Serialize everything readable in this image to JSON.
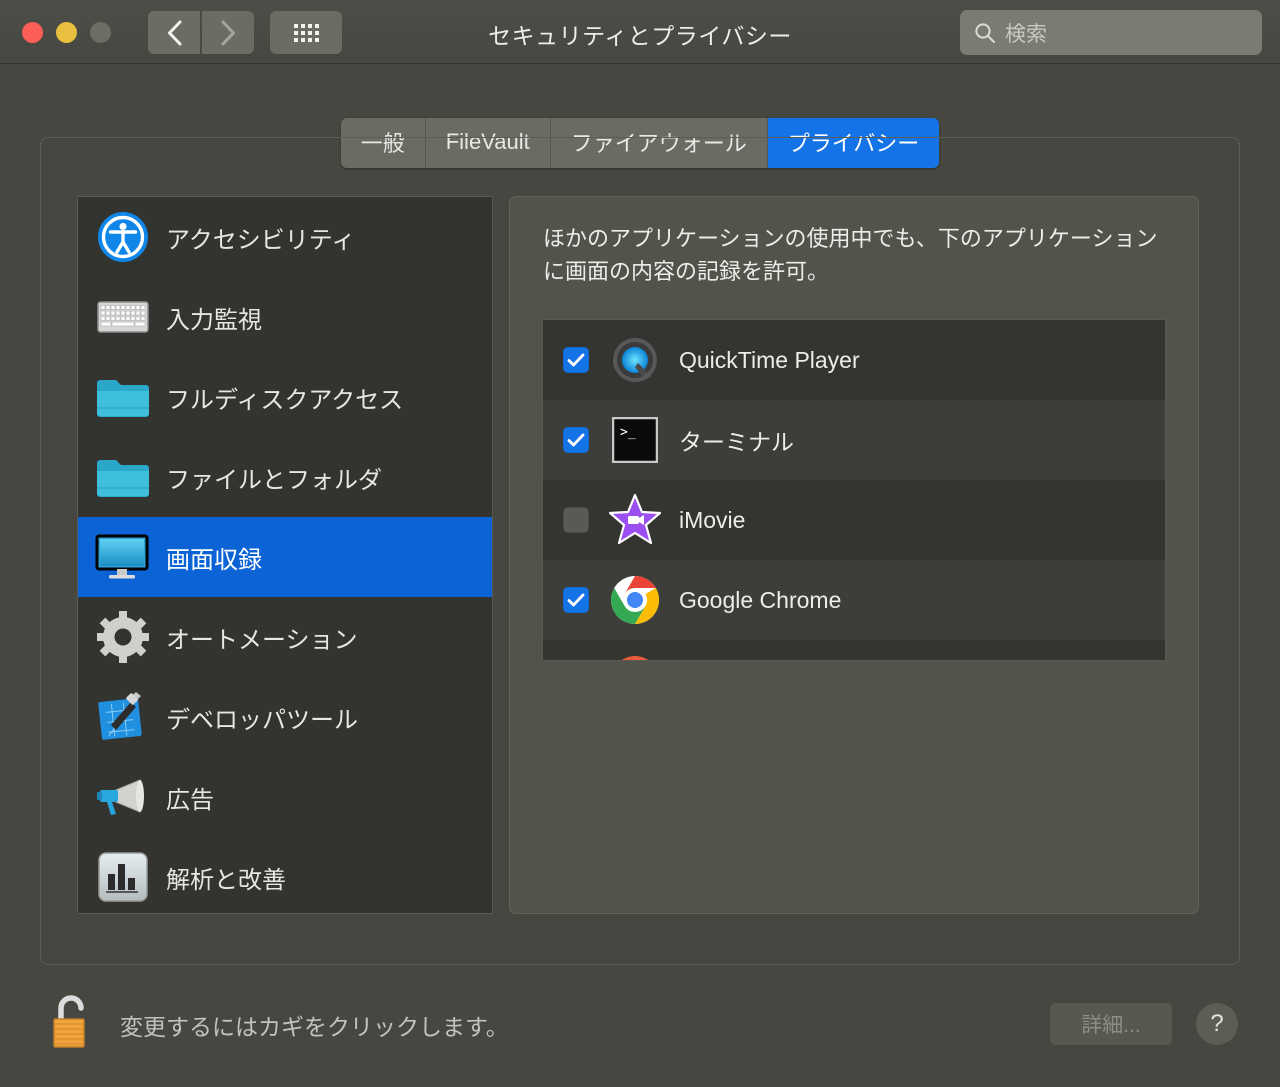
{
  "window": {
    "title": "セキュリティとプライバシー",
    "traffic_lights": [
      {
        "name": "close",
        "color": "#fb5f57"
      },
      {
        "name": "minimize",
        "color": "#e9bf3f"
      },
      {
        "name": "zoom",
        "color": "#6d6d66"
      }
    ]
  },
  "toolbar": {
    "back_icon": "chevron-left-icon",
    "forward_icon": "chevron-right-icon",
    "grid_icon": "show-all-grid-icon"
  },
  "search": {
    "icon": "search-icon",
    "placeholder": "検索",
    "value": ""
  },
  "tabs": [
    {
      "label": "一般",
      "selected": false
    },
    {
      "label": "FileVault",
      "selected": false
    },
    {
      "label": "ファイアウォール",
      "selected": false
    },
    {
      "label": "プライバシー",
      "selected": true
    }
  ],
  "sidebar": {
    "items": [
      {
        "label": "アクセシビリティ",
        "icon": "accessibility-icon",
        "selected": false
      },
      {
        "label": "入力監視",
        "icon": "keyboard-icon",
        "selected": false
      },
      {
        "label": "フルディスクアクセス",
        "icon": "folder-icon",
        "selected": false
      },
      {
        "label": "ファイルとフォルダ",
        "icon": "folder-icon",
        "selected": false
      },
      {
        "label": "画面収録",
        "icon": "display-icon",
        "selected": true
      },
      {
        "label": "オートメーション",
        "icon": "gear-icon",
        "selected": false
      },
      {
        "label": "デベロッパツール",
        "icon": "xcode-hammer-icon",
        "selected": false
      },
      {
        "label": "広告",
        "icon": "megaphone-icon",
        "selected": false
      },
      {
        "label": "解析と改善",
        "icon": "bar-chart-icon",
        "selected": false
      }
    ]
  },
  "panel": {
    "description": "ほかのアプリケーションの使用中でも、下のアプリケーションに画面の内容の記録を許可。",
    "apps": [
      {
        "name": "QuickTime Player",
        "icon": "quicktime-icon",
        "checked": true
      },
      {
        "name": "ターミナル",
        "icon": "terminal-icon",
        "checked": true
      },
      {
        "name": "iMovie",
        "icon": "imovie-icon",
        "checked": false
      },
      {
        "name": "Google Chrome",
        "icon": "chrome-icon",
        "checked": true
      }
    ]
  },
  "footer": {
    "lock_icon": "open-lock-icon",
    "lock_text": "変更するにはカギをクリックします。",
    "details_label": "詳細...",
    "help_label": "?"
  },
  "colors": {
    "accent_blue": "#1473e6",
    "selection_blue": "#0b63d6",
    "window_bg": "#474741",
    "sidebar_bg": "#333330",
    "panel_bg": "#53534c",
    "list_bg": "#343431",
    "lock_orange": "#f2a33c"
  }
}
